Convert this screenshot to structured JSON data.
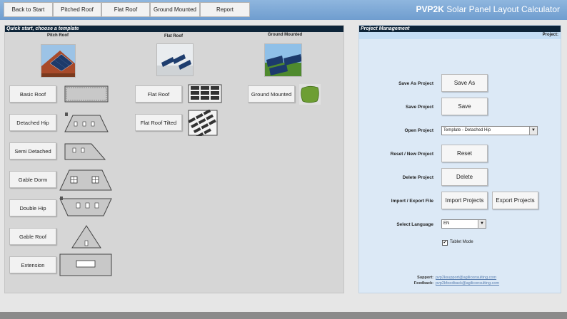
{
  "nav": {
    "back": "Back to Start",
    "pitched": "Pitched Roof",
    "flat": "Flat Roof",
    "ground": "Ground Mounted",
    "report": "Report"
  },
  "app_title_bold": "PVP2K",
  "app_title_rest": " Solar Panel Layout Calculator",
  "left": {
    "heading": "Quick start, choose a template",
    "col_pitch": "Pitch Roof",
    "col_flat": "Flat Roof",
    "col_ground": "Ground Mounted",
    "pitch_buttons": [
      "Basic Roof",
      "Detached Hip",
      "Semi Detached",
      "Gable Dorm",
      "Double Hip",
      "Gable Roof",
      "Extension"
    ],
    "flat_buttons": [
      "Flat Roof",
      "Flat Roof Tilted"
    ],
    "ground_buttons": [
      "Ground Mounted"
    ]
  },
  "right": {
    "heading": "Project Management",
    "project_label": "Project:",
    "save_as_label": "Save As Project",
    "save_as_btn": "Save As",
    "save_label": "Save Project",
    "save_btn": "Save",
    "open_label": "Open Project",
    "open_value": "Template - Detached Hip",
    "reset_label": "Reset / New Project",
    "reset_btn": "Reset",
    "delete_label": "Delete Project",
    "delete_btn": "Delete",
    "importexport_label": "Import / Export File",
    "import_btn": "Import Projects",
    "export_btn": "Export Projects",
    "language_label": "Select Language",
    "language_value": "EN",
    "tablet_mode": "Tablet Mode",
    "support_label": "Support:",
    "support_email": "pvp2ksupport@agiliconsulting.com",
    "feedback_label": "Feedback:",
    "feedback_email": "pvp2kfeedback@agiliconsulting.com"
  }
}
